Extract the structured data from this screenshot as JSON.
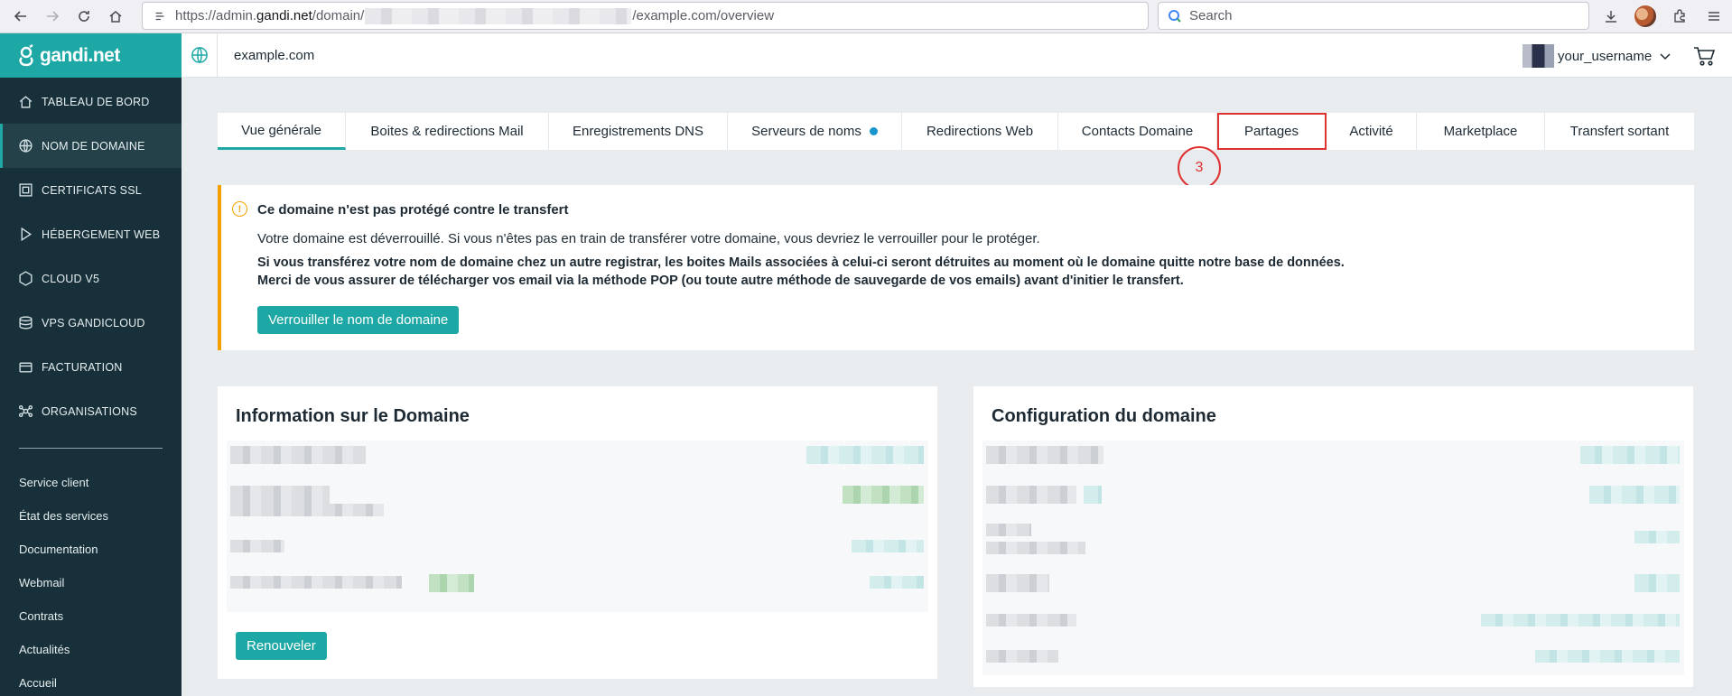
{
  "browser": {
    "url_prefix": "https://admin.",
    "url_host": "gandi.net",
    "url_path1": "/domain/",
    "url_path2": "/example.com/overview",
    "search_placeholder": "Search"
  },
  "sidebar": {
    "logo": "gandi.net",
    "nav_items": [
      {
        "label": "TABLEAU DE BORD",
        "icon": "home-icon"
      },
      {
        "label": "NOM DE DOMAINE",
        "icon": "globe-icon",
        "active": true
      },
      {
        "label": "CERTIFICATS SSL",
        "icon": "certificate-icon"
      },
      {
        "label": "HÉBERGEMENT WEB",
        "icon": "hosting-icon"
      },
      {
        "label": "CLOUD V5",
        "icon": "cloud-icon"
      },
      {
        "label": "VPS GANDICLOUD",
        "icon": "server-icon"
      },
      {
        "label": "FACTURATION",
        "icon": "billing-icon"
      },
      {
        "label": "ORGANISATIONS",
        "icon": "organizations-icon"
      }
    ],
    "links": [
      "Service client",
      "État des services",
      "Documentation",
      "Webmail",
      "Contrats",
      "Actualités",
      "Accueil"
    ]
  },
  "header": {
    "domain": "example.com",
    "username": "your_username"
  },
  "tabs": [
    {
      "label": "Vue générale",
      "active": true
    },
    {
      "label": "Boites & redirections Mail"
    },
    {
      "label": "Enregistrements DNS"
    },
    {
      "label": "Serveurs de noms",
      "dot": true
    },
    {
      "label": "Redirections Web"
    },
    {
      "label": "Contacts Domaine"
    },
    {
      "label": "Partages",
      "highlight": true
    },
    {
      "label": "Activité"
    },
    {
      "label": "Marketplace"
    },
    {
      "label": "Transfert sortant"
    }
  ],
  "step_badge": "3",
  "warning": {
    "title": "Ce domaine n'est pas protégé contre le transfert",
    "text": "Votre domaine est déverrouillé. Si vous n'êtes pas en train de transférer votre domaine, vous devriez le verrouiller pour le protéger.",
    "bold1": "Si vous transférez votre nom de domaine chez un autre registrar, les boites Mails associées à celui-ci seront détruites au moment où le domaine quitte notre base de données.",
    "bold2": "Merci de vous assurer de télécharger vos email via la méthode POP (ou toute autre méthode de sauvegarde de vos emails) avant d'initier le transfert.",
    "button": "Verrouiller le nom de domaine"
  },
  "info_card": {
    "title": "Information sur le Domaine",
    "button": "Renouveler"
  },
  "config_card": {
    "title": "Configuration du domaine"
  },
  "colors": {
    "brand": "#1ea8a5",
    "sidebar": "#173039",
    "warning": "#f59f00",
    "annotation": "#e03131"
  }
}
